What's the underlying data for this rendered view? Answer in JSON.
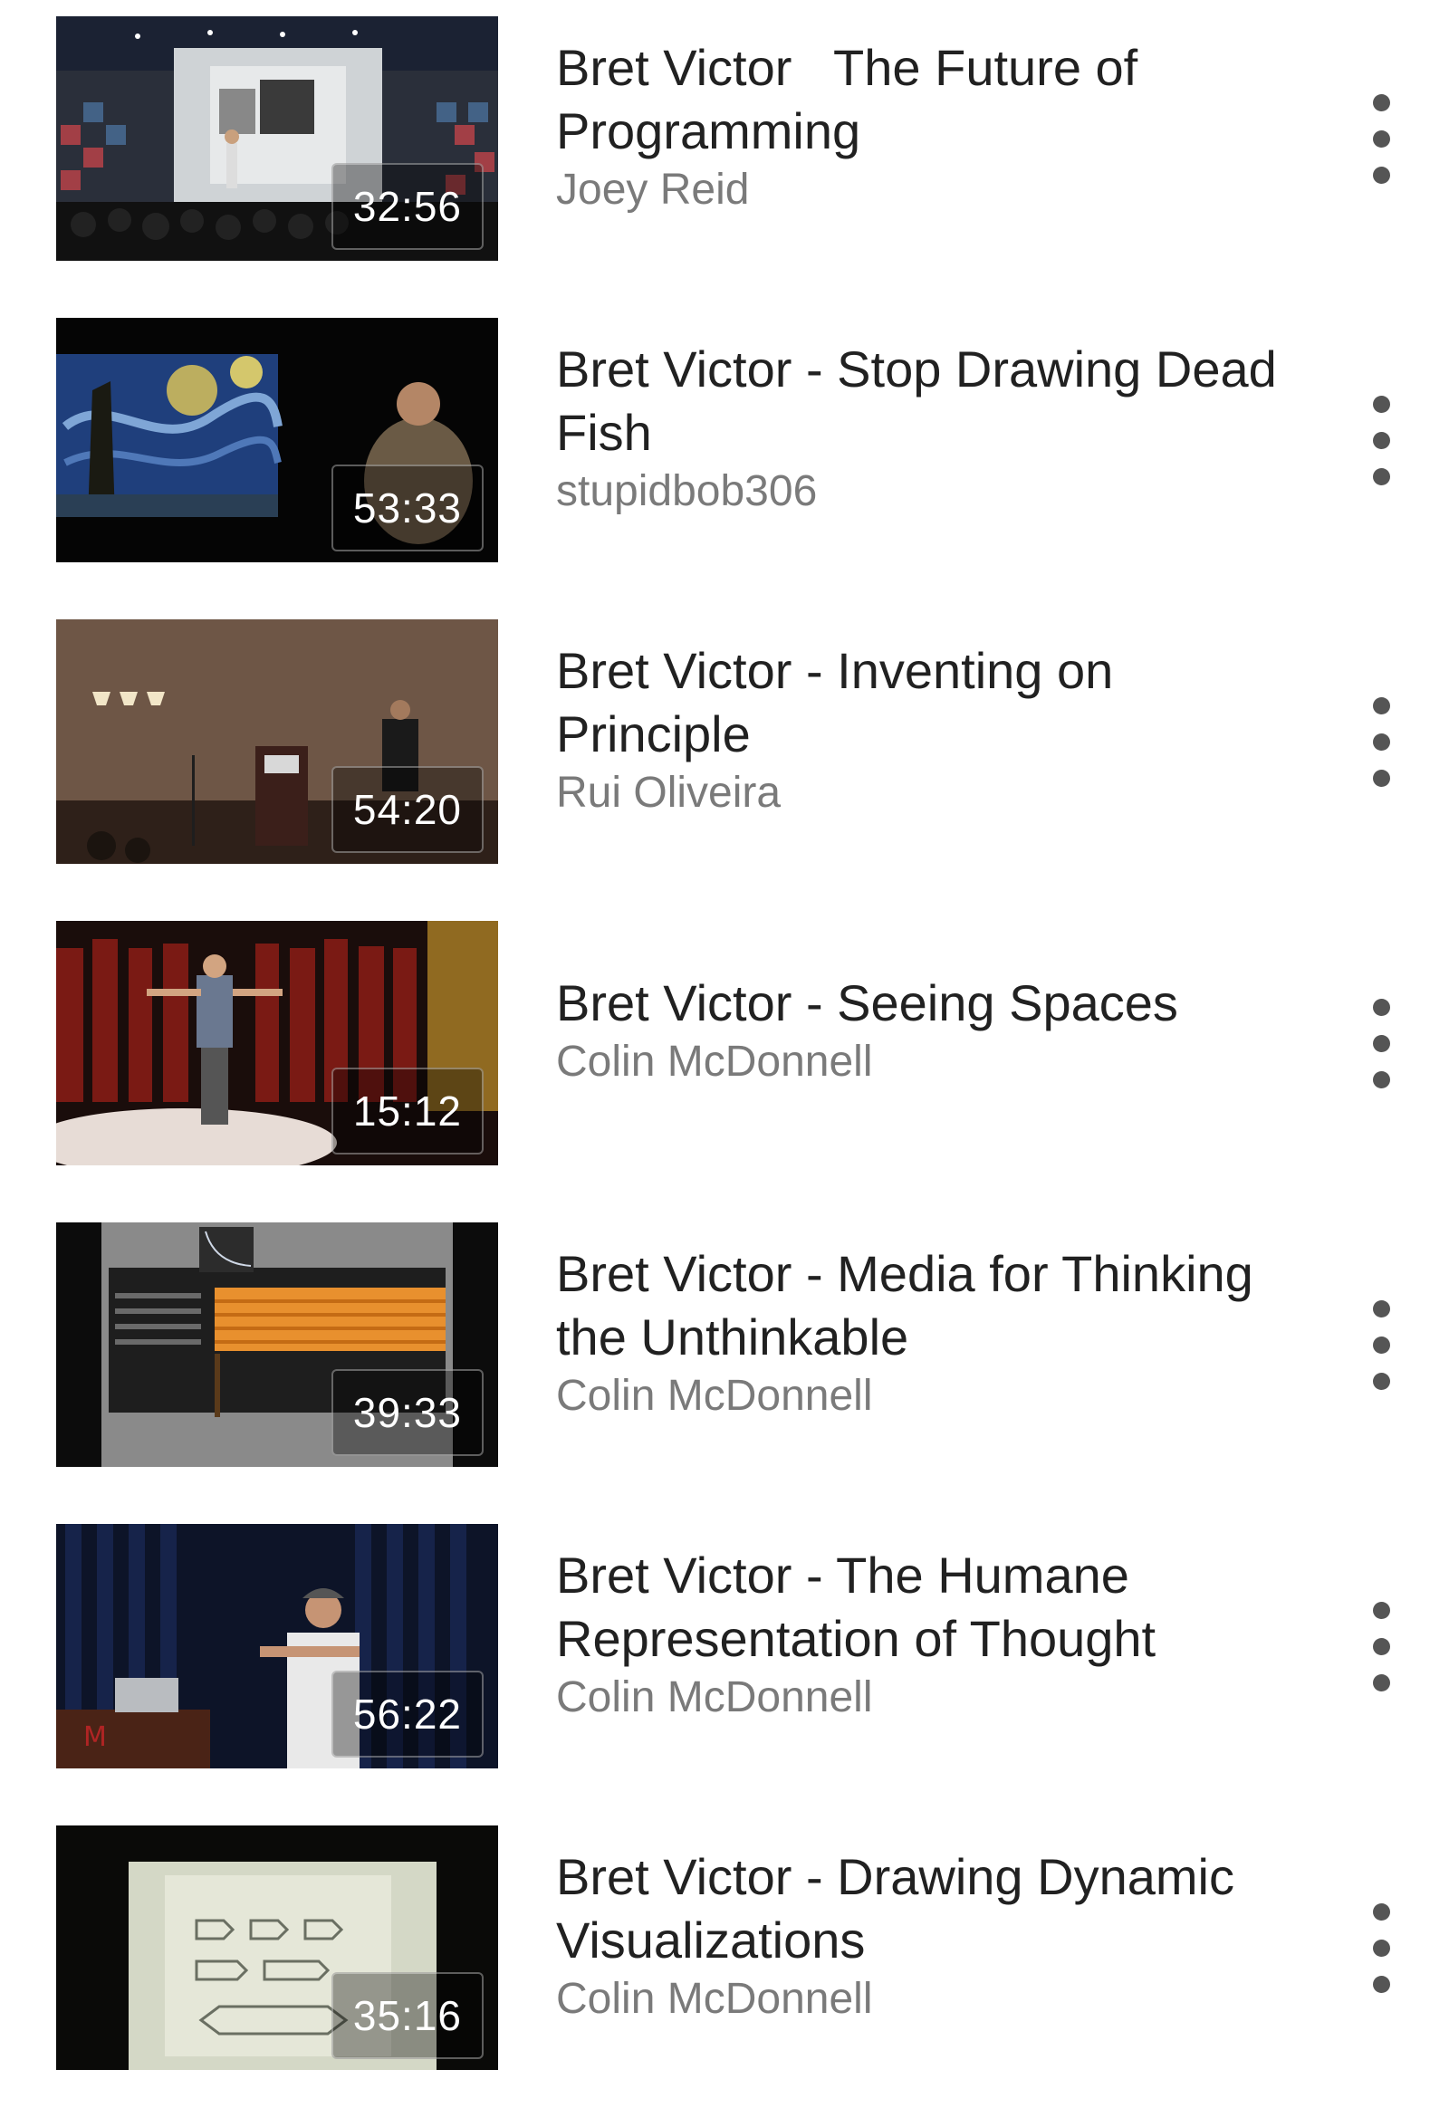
{
  "videos": [
    {
      "title": "Bret Victor   The Future of Programming",
      "channel": "Joey Reid",
      "duration": "32:56",
      "thumb_icon": "stage-talk-thumbnail"
    },
    {
      "title": "Bret Victor - Stop Drawing Dead Fish",
      "channel": "stupidbob306",
      "duration": "53:33",
      "thumb_icon": "starry-night-talk-thumbnail"
    },
    {
      "title": "Bret Victor - Inventing on Principle",
      "channel": "Rui Oliveira",
      "duration": "54:20",
      "thumb_icon": "podium-talk-thumbnail"
    },
    {
      "title": "Bret Victor - Seeing Spaces",
      "channel": "Colin McDonnell",
      "duration": "15:12",
      "thumb_icon": "red-curtain-stage-thumbnail"
    },
    {
      "title": "Bret Victor - Media for Thinking the Unthinkable",
      "channel": "Colin McDonnell",
      "duration": "39:33",
      "thumb_icon": "interface-demo-thumbnail"
    },
    {
      "title": "Bret Victor - The Humane Representation of Thought",
      "channel": "Colin McDonnell",
      "duration": "56:22",
      "thumb_icon": "speaker-with-laptop-thumbnail"
    },
    {
      "title": "Bret Victor - Drawing Dynamic Visualizations",
      "channel": "Colin McDonnell",
      "duration": "35:16",
      "thumb_icon": "slide-diagram-thumbnail"
    }
  ]
}
